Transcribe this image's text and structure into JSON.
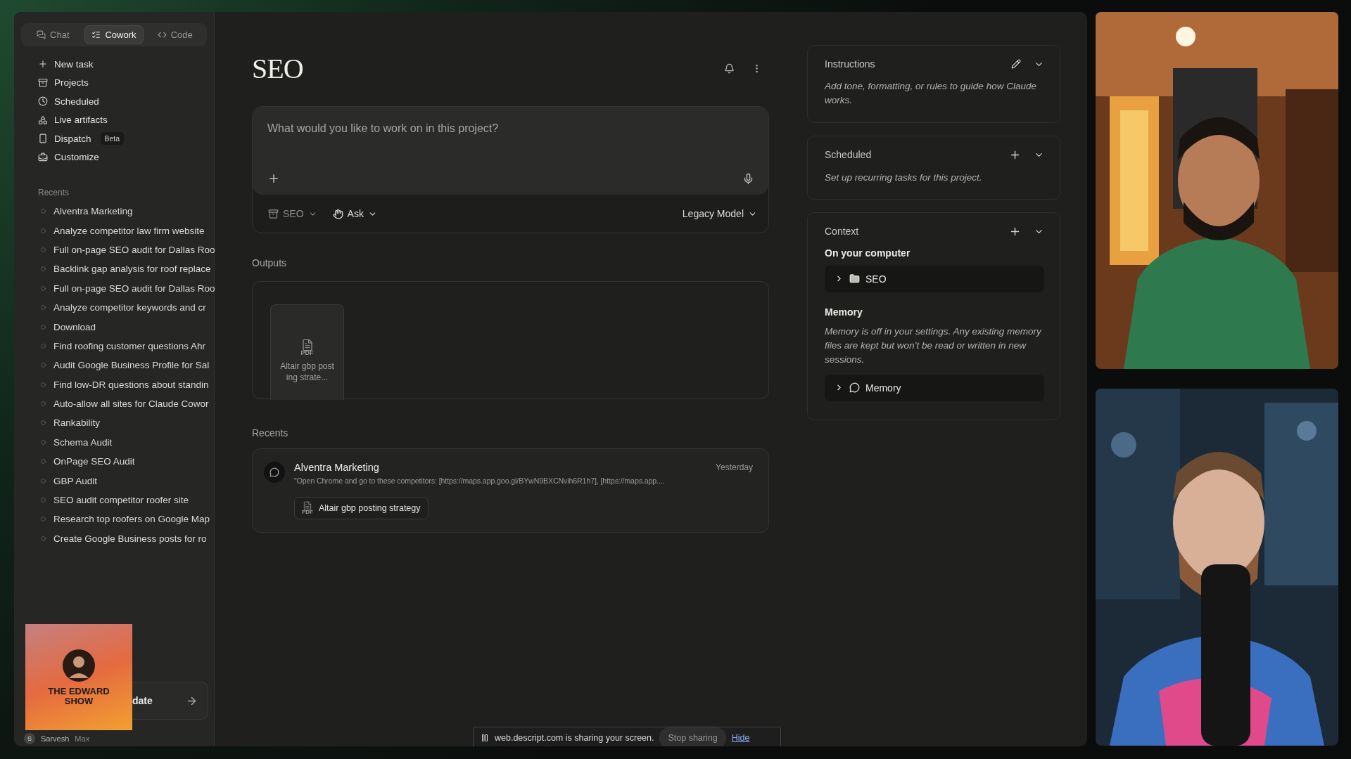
{
  "tabs": [
    {
      "label": "Chat",
      "selected": false
    },
    {
      "label": "Cowork",
      "selected": true
    },
    {
      "label": "Code",
      "selected": false
    }
  ],
  "nav": [
    {
      "label": "New task"
    },
    {
      "label": "Projects"
    },
    {
      "label": "Scheduled"
    },
    {
      "label": "Live artifacts"
    },
    {
      "label": "Dispatch",
      "badge": "Beta"
    },
    {
      "label": "Customize"
    }
  ],
  "recents_label": "Recents",
  "recents": [
    "Alventra Marketing",
    "Analyze competitor law firm website",
    "Full on-page SEO audit for Dallas Roo",
    "Backlink gap analysis for roof replace",
    "Full on-page SEO audit for Dallas Roo",
    "Analyze competitor keywords and cr",
    "Download",
    "Find roofing customer questions Ahr",
    "Audit Google Business Profile for Sal",
    "Find low-DR questions about standin",
    "Auto-allow all sites for Claude Cowor",
    "Rankability",
    "Schema Audit",
    "OnPage SEO Audit",
    "GBP Audit",
    "SEO audit competitor roofer site",
    "Research top roofers on Google Map",
    "Create Google Business posts for ro"
  ],
  "update_card": {
    "text": "date"
  },
  "user": {
    "initial": "S",
    "name": "Sarvesh",
    "plan": "Max"
  },
  "show_logo": {
    "title": "THE EDWARD SHOW"
  },
  "project": {
    "title": "SEO"
  },
  "composer": {
    "placeholder": "What would you like to work on in this project?",
    "project_chip": "SEO",
    "mode_chip": "Ask",
    "model": "Legacy Model"
  },
  "outputs": {
    "label": "Outputs",
    "files": [
      {
        "type": "PDF",
        "name": "Altair gbp posting strate..."
      }
    ]
  },
  "recent_tasks": {
    "label": "Recents",
    "items": [
      {
        "title": "Alventra Marketing",
        "time": "Yesterday",
        "snippet": "\"Open Chrome and go to these competitors: [https://maps.app.goo.gl/BYwN9BXCNvih6R1h7], [https://maps.app....",
        "attachment": {
          "type": "PDF",
          "name": "Altair gbp posting strategy"
        }
      }
    ]
  },
  "panel": [
    {
      "kind": "instructions",
      "title": "Instructions",
      "text": "Add tone, formatting, or rules to guide how Claude works."
    },
    {
      "kind": "scheduled",
      "title": "Scheduled",
      "text": "Set up recurring tasks for this project."
    },
    {
      "kind": "context",
      "title": "Context",
      "sections": [
        {
          "heading": "On your computer",
          "kind": "folder",
          "item": "SEO",
          "expanded": false
        },
        {
          "heading": "Memory",
          "text": "Memory is off in your settings. Any existing memory files are kept but won’t be read or written in new sessions.",
          "kind": "memory",
          "item": "Memory",
          "expanded": false
        }
      ]
    }
  ],
  "share_bar": {
    "text": "web.descript.com is sharing your screen.",
    "stop": "Stop sharing",
    "hide": "Hide"
  }
}
